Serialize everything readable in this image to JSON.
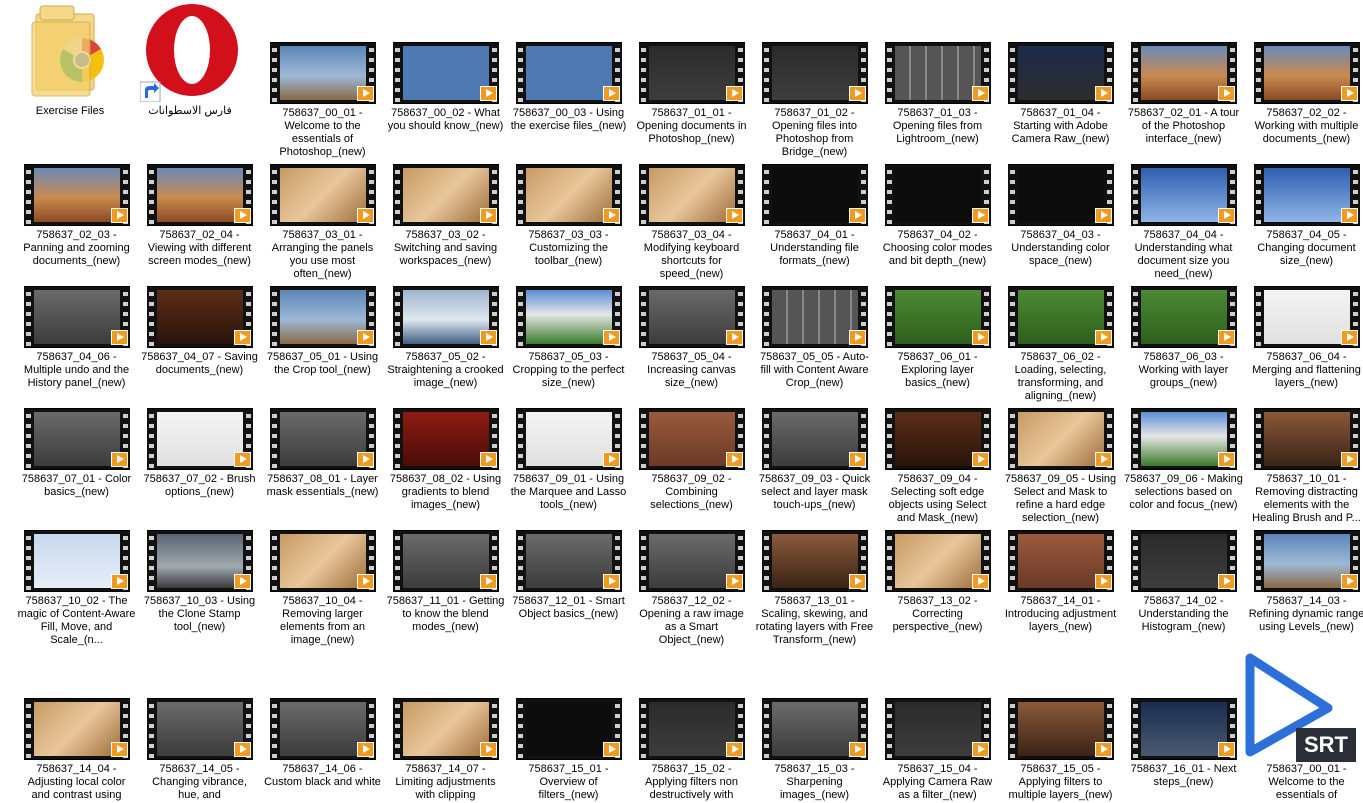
{
  "desktop_items": [
    {
      "label": "Exercise Files",
      "icon": "chrome-folder-icon"
    },
    {
      "label": "فارس الاسطوانات",
      "icon": "opera-shortcut-icon"
    }
  ],
  "srt_file": {
    "badge": "SRT",
    "icon": "srt-video-file-icon"
  },
  "videos": [
    {
      "label": "758637_00_01 - Welcome to the essentials of Photoshop_(new)",
      "theme": "sky"
    },
    {
      "label": "758637_00_02 - What you should know_(new)",
      "theme": "blue"
    },
    {
      "label": "758637_00_03 - Using the exercise files_(new)",
      "theme": "blue"
    },
    {
      "label": "758637_01_01 - Opening documents in Photoshop_(new)",
      "theme": "dark"
    },
    {
      "label": "758637_01_02 - Opening files into Photoshop from Bridge_(new)",
      "theme": "dark"
    },
    {
      "label": "758637_01_03 - Opening files from Lightroom_(new)",
      "theme": "grid"
    },
    {
      "label": "758637_01_04 - Starting with Adobe Camera Raw_(new)",
      "theme": "adobe"
    },
    {
      "label": "758637_02_01 - A tour of the Photoshop interface_(new)",
      "theme": "desert"
    },
    {
      "label": "758637_02_02 - Working with multiple documents_(new)",
      "theme": "desert"
    },
    {
      "label": "758637_02_03 - Panning and zooming documents_(new)",
      "theme": "desert"
    },
    {
      "label": "758637_02_04 - Viewing with different screen modes_(new)",
      "theme": "desert"
    },
    {
      "label": "758637_03_01 - Arranging the panels you use most often_(new)",
      "theme": "sand"
    },
    {
      "label": "758637_03_02 - Switching and saving workspaces_(new)",
      "theme": "sand"
    },
    {
      "label": "758637_03_03 - Customizing the toolbar_(new)",
      "theme": "sand"
    },
    {
      "label": "758637_03_04 - Modifying keyboard shortcuts for speed_(new)",
      "theme": "sand"
    },
    {
      "label": "758637_04_01 - Understanding file formats_(new)",
      "theme": "black"
    },
    {
      "label": "758637_04_02 - Choosing color modes and bit depth_(new)",
      "theme": "black"
    },
    {
      "label": "758637_04_03 - Understanding color space_(new)",
      "theme": "black"
    },
    {
      "label": "758637_04_04 - Understanding what document size you need_(new)",
      "theme": "bluesky"
    },
    {
      "label": "758637_04_05 - Changing document size_(new)",
      "theme": "bluesky"
    },
    {
      "label": "758637_04_06 - Multiple undo and the History panel_(new)",
      "theme": "gray"
    },
    {
      "label": "758637_04_07 - Saving documents_(new)",
      "theme": "brown"
    },
    {
      "label": "758637_05_01 - Using the Crop tool_(new)",
      "theme": "sky"
    },
    {
      "label": "758637_05_02 - Straightening a crooked image_(new)",
      "theme": "ice"
    },
    {
      "label": "758637_05_03 - Cropping to the perfect size_(new)",
      "theme": "field"
    },
    {
      "label": "758637_05_04 - Increasing canvas size_(new)",
      "theme": "gray"
    },
    {
      "label": "758637_05_05 - Auto-fill with Content Aware Crop_(new)",
      "theme": "grid"
    },
    {
      "label": "758637_06_01 - Exploring layer basics_(new)",
      "theme": "green"
    },
    {
      "label": "758637_06_02 - Loading, selecting, transforming, and aligning_(new)",
      "theme": "green"
    },
    {
      "label": "758637_06_03 - Working with layer groups_(new)",
      "theme": "green"
    },
    {
      "label": "758637_06_04 - Merging and flattening layers_(new)",
      "theme": "white"
    },
    {
      "label": "758637_07_01 - Color basics_(new)",
      "theme": "gray"
    },
    {
      "label": "758637_07_02 - Brush options_(new)",
      "theme": "white"
    },
    {
      "label": "758637_08_01 - Layer mask essentials_(new)",
      "theme": "gray"
    },
    {
      "label": "758637_08_02 - Using gradients to blend images_(new)",
      "theme": "red"
    },
    {
      "label": "758637_09_01 - Using the Marquee and Lasso tools_(new)",
      "theme": "white"
    },
    {
      "label": "758637_09_02 - Combining selections_(new)",
      "theme": "brick"
    },
    {
      "label": "758637_09_03 - Quick select and layer mask touch-ups_(new)",
      "theme": "gray"
    },
    {
      "label": "758637_09_04 - Selecting soft edge objects using Select and Mask_(new)",
      "theme": "brown"
    },
    {
      "label": "758637_09_05 - Using Select and Mask to refine a hard edge selection_(new)",
      "theme": "sand"
    },
    {
      "label": "758637_09_06 - Making selections based on color and focus_(new)",
      "theme": "field"
    },
    {
      "label": "758637_10_01 - Removing distracting elements with the Healing Brush and P...",
      "theme": "rust"
    },
    {
      "label": "758637_10_02 - The magic of Content-Aware Fill, Move, and Scale_(n...",
      "theme": "paleblue"
    },
    {
      "label": "758637_10_03 - Using the Clone Stamp tool_(new)",
      "theme": "storm"
    },
    {
      "label": "758637_10_04 - Removing larger elements from an image_(new)",
      "theme": "sand"
    },
    {
      "label": "758637_11_01 - Getting to know the blend modes_(new)",
      "theme": "gray"
    },
    {
      "label": "758637_12_01 - Smart Object basics_(new)",
      "theme": "gray"
    },
    {
      "label": "758637_12_02 - Opening a raw image as a Smart Object_(new)",
      "theme": "gray"
    },
    {
      "label": "758637_13_01 - Scaling, skewing, and rotating layers with Free Transform_(new)",
      "theme": "rust"
    },
    {
      "label": "758637_13_02 - Correcting perspective_(new)",
      "theme": "sand"
    },
    {
      "label": "758637_14_01 - Introducing adjustment layers_(new)",
      "theme": "brick"
    },
    {
      "label": "758637_14_02 - Understanding the Histogram_(new)",
      "theme": "dark"
    },
    {
      "label": "758637_14_03 - Refining dynamic range using Levels_(new)",
      "theme": "sky"
    },
    {
      "label": "758637_14_04 - Adjusting local color and contrast using",
      "theme": "sand"
    },
    {
      "label": "758637_14_05 - Changing vibrance, hue, and",
      "theme": "gray"
    },
    {
      "label": "758637_14_06 - Custom black and white",
      "theme": "gray"
    },
    {
      "label": "758637_14_07 - Limiting adjustments with clipping",
      "theme": "sand"
    },
    {
      "label": "758637_15_01 - Overview of filters_(new)",
      "theme": "black"
    },
    {
      "label": "758637_15_02 - Applying filters non destructively with",
      "theme": "dark"
    },
    {
      "label": "758637_15_03 - Sharpening images_(new)",
      "theme": "gray"
    },
    {
      "label": "758637_15_04 - Applying Camera Raw as a filter_(new)",
      "theme": "dark"
    },
    {
      "label": "758637_15_05 - Applying filters to multiple layers_(new)",
      "theme": "rust"
    },
    {
      "label": "758637_16_01 - Next steps_(new)",
      "theme": "navy"
    },
    {
      "label": "758637_00_01 - Welcome to the essentials of",
      "theme": "none"
    }
  ],
  "themes": {
    "sky": "linear-gradient(#5d86b8,#9db8d6 55%,#8a6a45)",
    "blue": "#4f79b2",
    "dark": "linear-gradient(#2b2b2b,#3d3d3d)",
    "grid": "repeating-linear-gradient(90deg,#555 0 14px,#888 14px 16px)",
    "adobe": "linear-gradient(#1b2b4a,#2c2c2c)",
    "desert": "linear-gradient(#6a8bb8,#c98a4e 55%,#8a4a25)",
    "sand": "linear-gradient(135deg,#c79a62,#e8c79b 50%,#9e6d3c)",
    "black": "#0c0c0c",
    "bluesky": "linear-gradient(#2f5fb0,#8fb4e6)",
    "gray": "linear-gradient(#6a6a6a,#3c3c3c)",
    "brown": "linear-gradient(#5a2e17,#2a140a)",
    "ice": "linear-gradient(#9fb6d0,#dfe8f0 55%,#3f5f80)",
    "field": "linear-gradient(#5b8ed6,#e6e6e6 45%,#3a7a2a)",
    "green": "linear-gradient(#4c8a34,#2e5f1c)",
    "white": "linear-gradient(#f4f4f4,#e0e0e0)",
    "red": "linear-gradient(#8e1b14,#4a0c08)",
    "brick": "linear-gradient(#9a5a3e,#6a3a26)",
    "rust": "linear-gradient(#8a5a3a,#3a2416)",
    "paleblue": "linear-gradient(#c6d9ee,#e6eef7)",
    "storm": "linear-gradient(#5a6470,#a0a8b0 60%,#3a3a3a)",
    "navy": "linear-gradient(#1a2c50,#4a5a70)",
    "none": "#ffffff"
  },
  "colors": {
    "play_badge": "#f19a1f",
    "srt_blue": "#2c6fd9",
    "srt_badge_bg": "#2b2f38"
  }
}
